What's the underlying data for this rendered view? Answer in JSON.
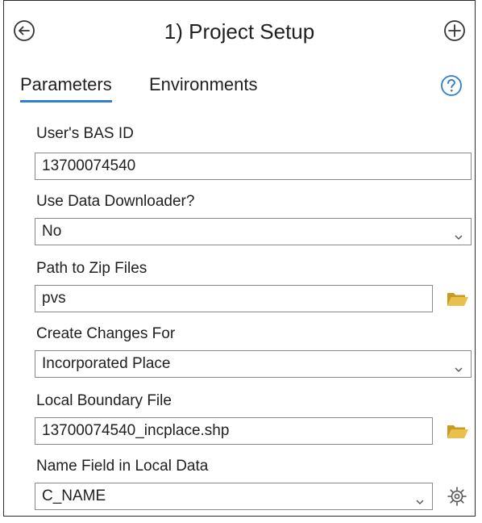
{
  "header": {
    "title": "1) Project Setup",
    "back_icon": "back-arrow-circle-icon",
    "add_icon": "plus-circle-icon"
  },
  "tabs": [
    {
      "label": "Parameters",
      "active": true
    },
    {
      "label": "Environments",
      "active": false
    }
  ],
  "help_icon": "help-question-icon",
  "colors": {
    "accent": "#2f7ecf",
    "folder": "#e2b736",
    "border": "#8a8a8a"
  },
  "fields": {
    "bas_id": {
      "label": "User's BAS ID",
      "value": "13700074540"
    },
    "use_downloader": {
      "label": "Use Data Downloader?",
      "value": "No"
    },
    "zip_path": {
      "label": "Path to Zip Files",
      "value": "pvs",
      "icon": "folder-open-icon"
    },
    "changes_for": {
      "label": "Create Changes For",
      "value": "Incorporated Place"
    },
    "boundary_file": {
      "label": "Local Boundary File",
      "value": "13700074540_incplace.shp",
      "icon": "folder-open-icon"
    },
    "name_field": {
      "label": "Name Field in Local Data",
      "value": "C_NAME",
      "icon": "gear-icon"
    }
  }
}
